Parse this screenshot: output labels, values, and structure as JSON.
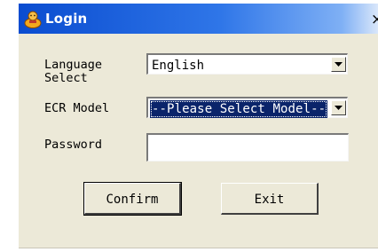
{
  "window": {
    "title": "Login",
    "close_glyph": "×",
    "icon": "user-keys-icon"
  },
  "form": {
    "language": {
      "label": "Language\nSelect",
      "value": "English"
    },
    "ecr_model": {
      "label": "ECR Model",
      "value": "--Please Select Model--"
    },
    "password": {
      "label": "Password",
      "value": ""
    }
  },
  "buttons": {
    "confirm_label": "Confirm",
    "exit_label": "Exit"
  },
  "colors": {
    "title_bar_start": "#0a4cd0",
    "dialog_background": "#ece9d8",
    "selection_highlight": "#0a246a"
  }
}
